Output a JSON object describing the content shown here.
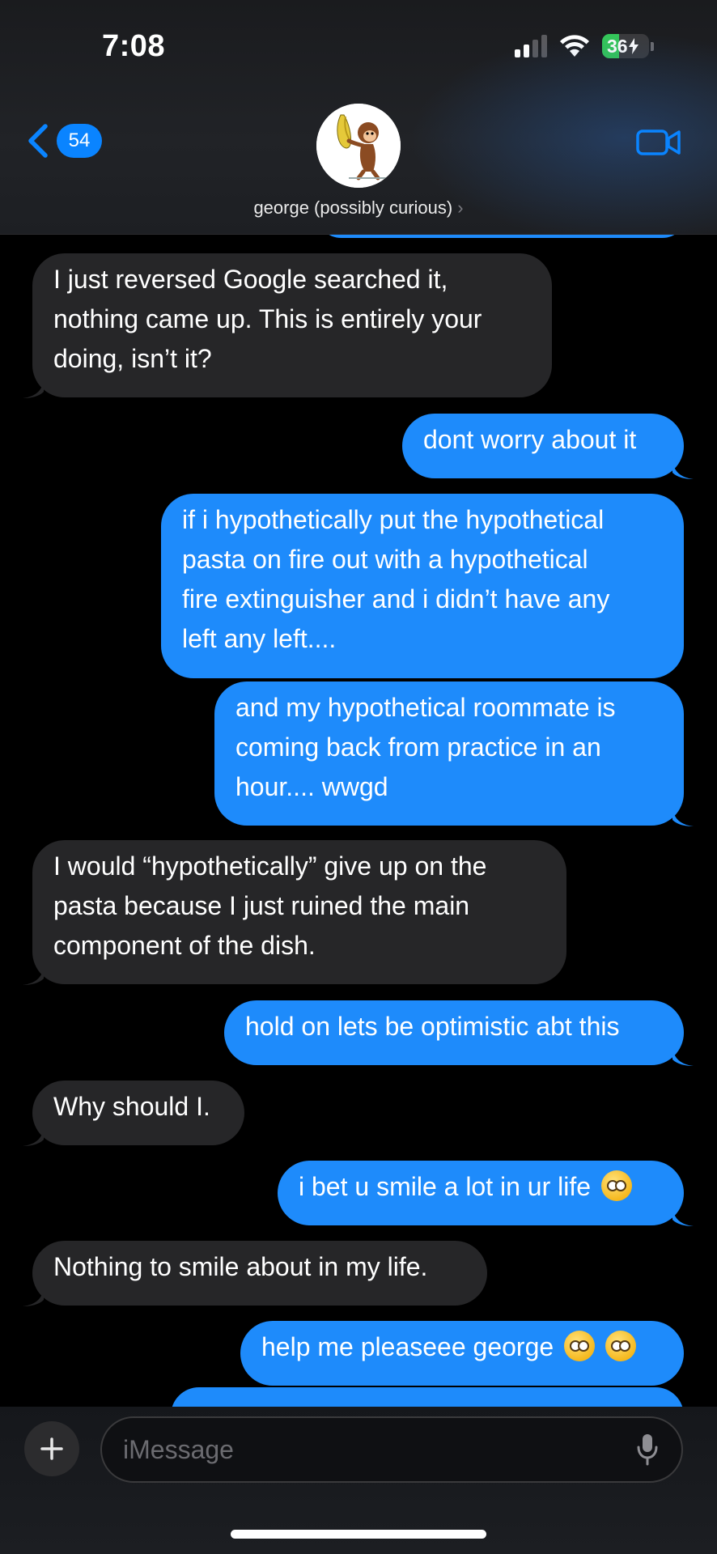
{
  "status_bar": {
    "time": "7:08",
    "battery_label": "36",
    "battery_level": 36
  },
  "header": {
    "back_count": "54",
    "contact_name": "george (possibly curious)",
    "contact_chevron": "›",
    "video_icon": "video-camera-icon",
    "avatar_description": "curious-george-avatar"
  },
  "messages": [
    {
      "direction": "incoming",
      "lines": [
        "I just reversed Google searched it,",
        "nothing came up. This is entirely your",
        "doing, isn’t it?"
      ]
    },
    {
      "direction": "outgoing",
      "lines": [
        "dont worry about it"
      ]
    },
    {
      "direction": "outgoing",
      "lines": [
        "if i hypothetically put the hypothetical",
        "pasta on fire out with a hypothetical",
        "fire extinguisher and i didn’t have any",
        "left any left...."
      ]
    },
    {
      "direction": "outgoing",
      "lines": [
        "and my hypothetical roommate is",
        "coming back from practice in an",
        "hour.... wwgd"
      ]
    },
    {
      "direction": "incoming",
      "lines": [
        "I would “hypothetically” give up on the",
        "pasta because I just ruined the main",
        "component of the dish."
      ]
    },
    {
      "direction": "outgoing",
      "lines": [
        "hold on lets be optimistic abt this"
      ]
    },
    {
      "direction": "incoming",
      "lines": [
        "Why should I."
      ]
    },
    {
      "direction": "outgoing",
      "lines": [
        "i bet u smile a lot in ur life"
      ],
      "emoji_count": 1
    },
    {
      "direction": "incoming",
      "lines": [
        "Nothing to smile about in my life."
      ]
    },
    {
      "direction": "outgoing",
      "lines": [
        "help me pleaseee george"
      ],
      "emoji_count": 2
    }
  ],
  "composer": {
    "placeholder": "iMessage",
    "plus_icon": "plus-icon",
    "mic_icon": "microphone-icon"
  },
  "colors": {
    "outgoing_bubble": "#1e8bfb",
    "incoming_bubble": "#262628",
    "accent": "#0a84ff",
    "battery_green": "#34c759"
  }
}
